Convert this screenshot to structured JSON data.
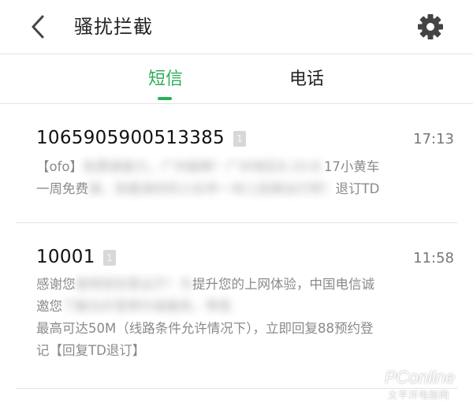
{
  "header": {
    "title": "骚扰拦截",
    "back_icon": "chevron-left-icon",
    "settings_icon": "gear-icon"
  },
  "tabs": [
    {
      "label": "短信",
      "active": true
    },
    {
      "label": "电话",
      "active": false
    }
  ],
  "accent_color": "#2cae5a",
  "messages": [
    {
      "sender": "1065905900513385",
      "sim_badge": "1",
      "time": "17:13",
      "body_lines": [
        {
          "clear": "【ofo】",
          "blurred": "免费骑接力，广州接棒！广州地区8.10-8.",
          "clear_end": "17小黄车"
        },
        {
          "clear": "一周免费",
          "blurred": "骑，快邀请你的小伙伴一块儿低碳出行吧！",
          "clear_end": "退订TD"
        }
      ]
    },
    {
      "sender": "10001",
      "sim_badge": "1",
      "time": "11:58",
      "body_lines": [
        {
          "clear": "感谢您",
          "blurred": "使用短信营业厅！为",
          "clear_end": "提升您的上网体验，中国电信诚"
        },
        {
          "clear": "邀您",
          "blurred": "了解光纤宽带升级服务，带宽",
          "clear_end": ""
        },
        {
          "clear": "最高可达50M（线路条件允许情况下），立即回复88预约登",
          "blurred": "",
          "clear_end": ""
        },
        {
          "clear": "记【回复TD退订】",
          "blurred": "",
          "clear_end": ""
        }
      ]
    }
  ],
  "watermark": {
    "brand": "PConline",
    "subtitle": "太平洋电脑网"
  }
}
